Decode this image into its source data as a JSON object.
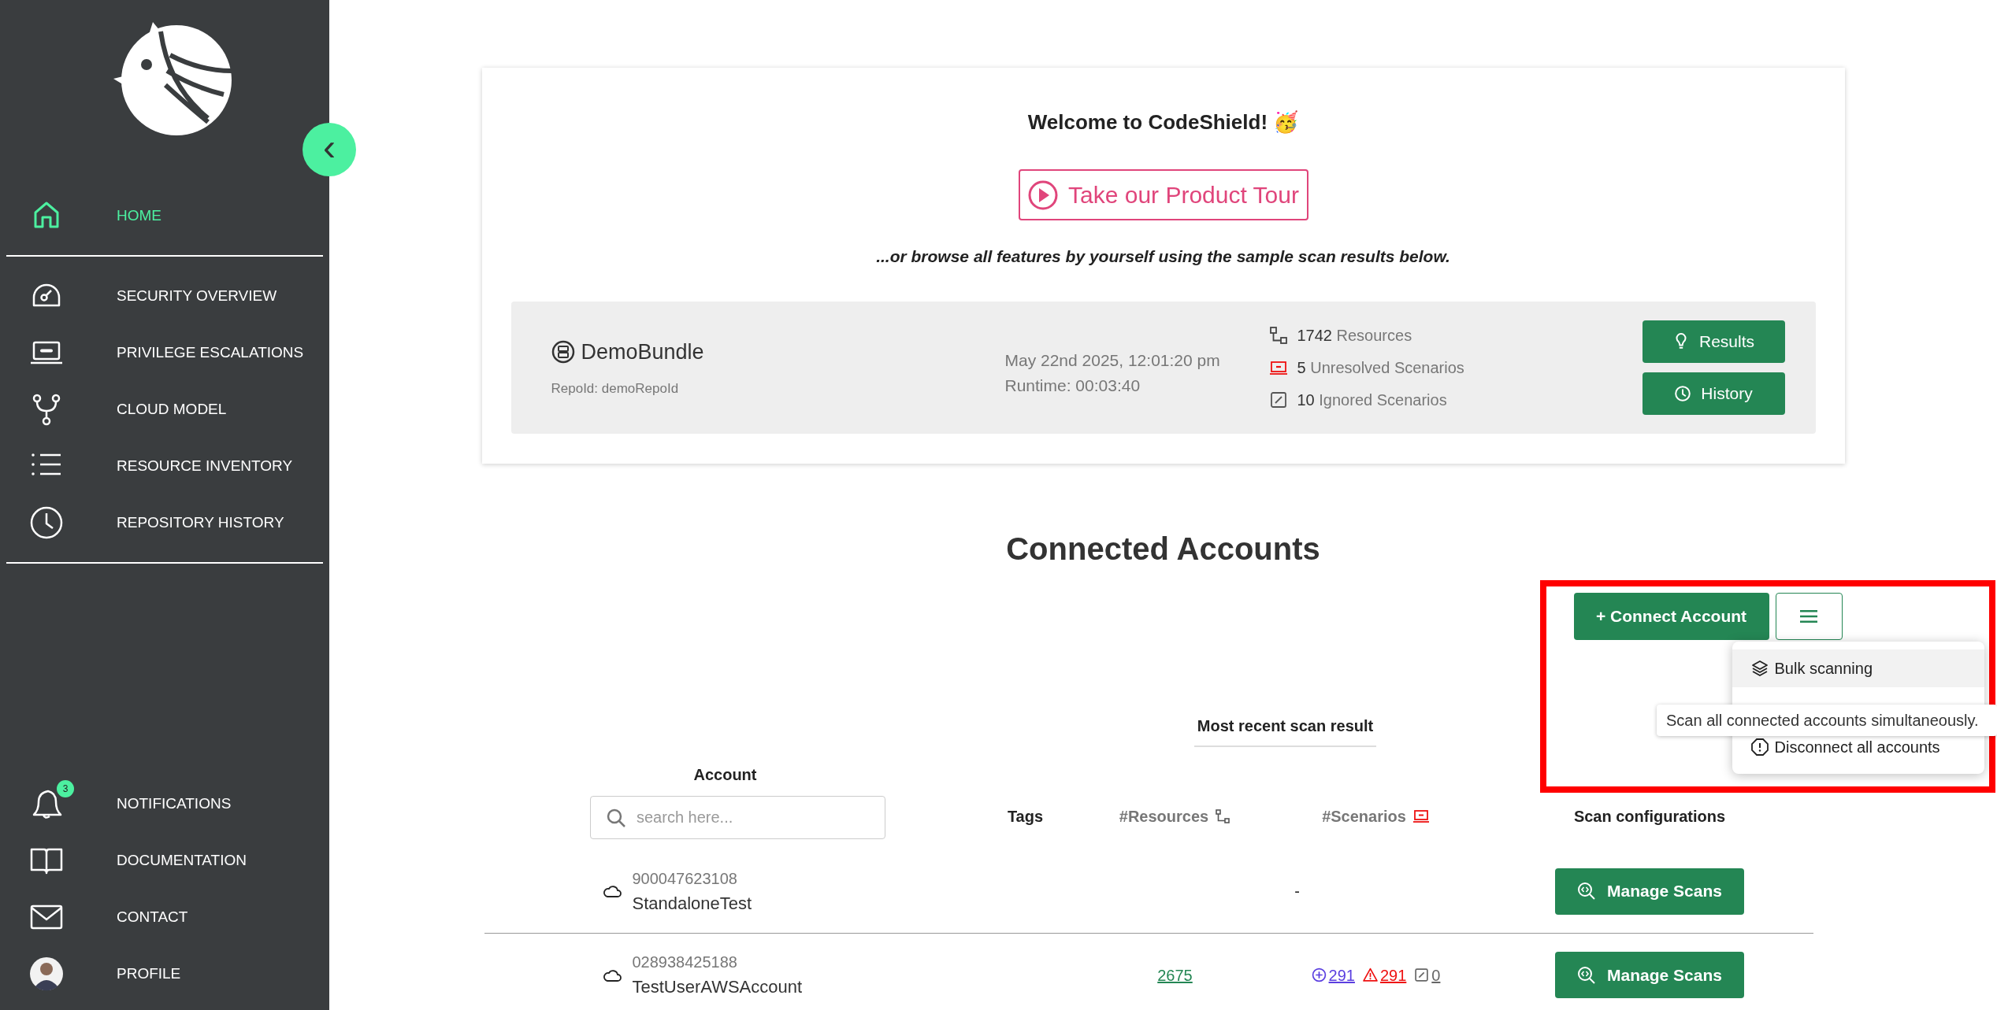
{
  "sidebar": {
    "collapse_icon": "‹",
    "top_items": [
      {
        "label": "HOME",
        "kind": "home",
        "selected": true
      },
      {
        "label": "SECURITY OVERVIEW",
        "kind": "gauge",
        "selected": false
      },
      {
        "label": "PRIVILEGE ESCALATIONS",
        "kind": "laptop",
        "selected": false
      },
      {
        "label": "CLOUD MODEL",
        "kind": "fork",
        "selected": false
      },
      {
        "label": "RESOURCE INVENTORY",
        "kind": "list",
        "selected": false
      },
      {
        "label": "REPOSITORY HISTORY",
        "kind": "clock",
        "selected": false
      }
    ],
    "bottom_items": [
      {
        "label": "NOTIFICATIONS",
        "kind": "bell",
        "badge": "3",
        "selected": false
      },
      {
        "label": "DOCUMENTATION",
        "kind": "book",
        "selected": false
      },
      {
        "label": "CONTACT",
        "kind": "mail",
        "selected": false
      },
      {
        "label": "PROFILE",
        "kind": "avatar",
        "selected": false
      }
    ]
  },
  "welcome": {
    "title": "Welcome to CodeShield! 🥳",
    "tour_button": "Take our Product Tour",
    "subtitle": "...or browse all features by yourself using the sample scan results below.",
    "demo": {
      "name": "DemoBundle",
      "repo_id": "RepoId: demoRepoId",
      "date": "May 22nd 2025, 12:01:20 pm",
      "runtime": "Runtime: 00:03:40",
      "stats": [
        {
          "kind": "resources",
          "count": "1742",
          "label": "Resources"
        },
        {
          "kind": "unresolved",
          "count": "5",
          "label": "Unresolved Scenarios"
        },
        {
          "kind": "ignored",
          "count": "10",
          "label": "Ignored Scenarios"
        }
      ],
      "buttons": [
        {
          "kind": "results",
          "label": "Results"
        },
        {
          "kind": "history",
          "label": "History"
        }
      ]
    }
  },
  "accounts": {
    "title": "Connected Accounts",
    "connect_button": "+ Connect Account",
    "menu": [
      {
        "kind": "layers",
        "label": "Bulk scanning",
        "selected": true
      },
      {
        "kind": "hidden"
      },
      {
        "kind": "alert",
        "label": "Disconnect all accounts",
        "selected": false
      }
    ],
    "tooltip": "Scan all connected accounts simultaneously.",
    "group_header": "Most recent scan result",
    "columns": {
      "account": "Account",
      "tags": "Tags",
      "resources": "#Resources",
      "scenarios": "#Scenarios",
      "scan": "Scan configurations"
    },
    "search": {
      "placeholder": "search here..."
    },
    "rows": [
      {
        "id": "900047623108",
        "name": "StandaloneTest",
        "resources": "",
        "scenarios": [],
        "empty_mark": "-",
        "action": "Manage Scans"
      },
      {
        "id": "028938425188",
        "name": "TestUserAWSAccount",
        "resources": "2675",
        "scenarios": [
          {
            "kind": "open",
            "value": "291"
          },
          {
            "kind": "warning",
            "value": "291"
          },
          {
            "kind": "ignored",
            "value": "0"
          }
        ],
        "action": "Manage Scans"
      }
    ]
  }
}
